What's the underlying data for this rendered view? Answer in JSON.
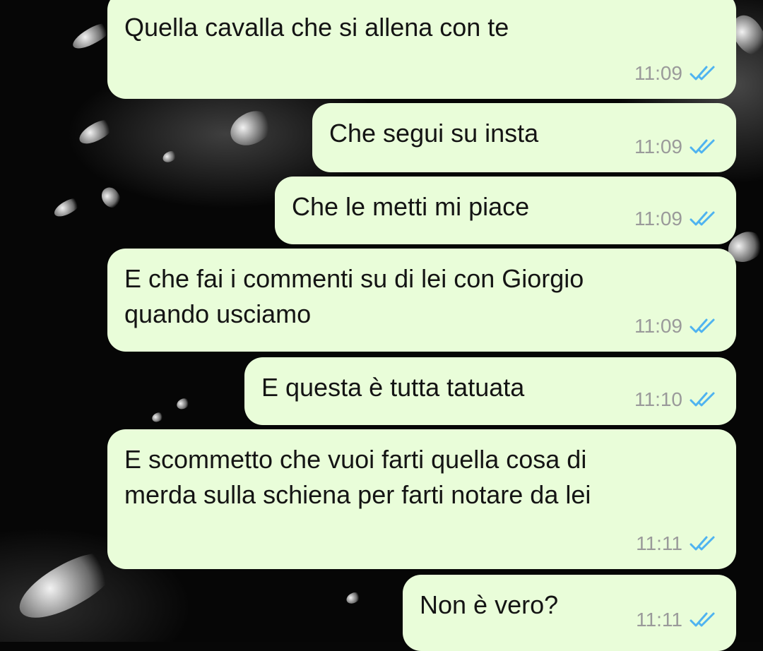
{
  "chat": {
    "theme": {
      "bubble_color": "#e9fdd9",
      "read_tick_color": "#4fb3f0",
      "time_color": "#9a9a9a"
    },
    "messages": [
      {
        "text": "Quella cavalla che si allena con te",
        "time": "11:09",
        "status": "read-double-check-icon"
      },
      {
        "text": "Che segui su insta",
        "time": "11:09",
        "status": "read-double-check-icon"
      },
      {
        "text": "Che le metti mi piace",
        "time": "11:09",
        "status": "read-double-check-icon"
      },
      {
        "text": "E che fai i commenti su di lei con Giorgio\nquando usciamo",
        "time": "11:09",
        "status": "read-double-check-icon"
      },
      {
        "text": "E questa è tutta tatuata",
        "time": "11:10",
        "status": "read-double-check-icon"
      },
      {
        "text": "E scommetto che vuoi farti quella cosa di\nmerda sulla schiena per farti notare da lei",
        "time": "11:11",
        "status": "read-double-check-icon"
      },
      {
        "text": "Non è vero?",
        "time": "11:11",
        "status": "read-double-check-icon"
      }
    ]
  }
}
